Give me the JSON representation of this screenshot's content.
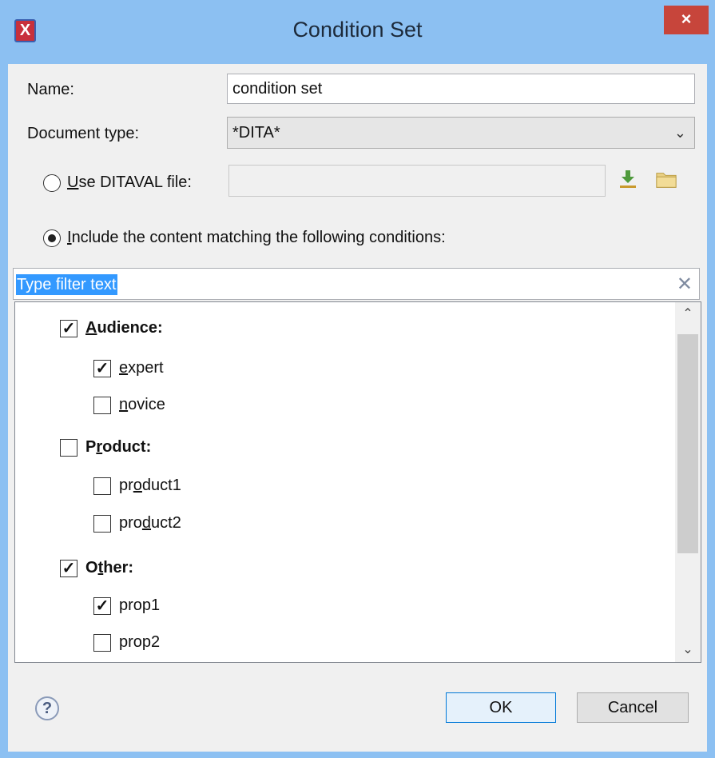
{
  "window": {
    "title": "Condition Set",
    "close_glyph": "×"
  },
  "form": {
    "name_label": "Name:",
    "name_value": "condition set",
    "doctype_label": "Document type:",
    "doctype_value": "*DITA*",
    "ditaval_label": "Use DITAVAL file:",
    "ditaval_value": "",
    "include_label": "Include the content matching the following conditions:",
    "filter_placeholder": "Type filter text"
  },
  "tree": [
    {
      "label": "Audience:",
      "checked": true,
      "children": [
        {
          "label": "expert",
          "checked": true
        },
        {
          "label": "novice",
          "checked": false
        }
      ]
    },
    {
      "label": "Product:",
      "checked": false,
      "children": [
        {
          "label": "product1",
          "checked": false
        },
        {
          "label": "product2",
          "checked": false
        }
      ]
    },
    {
      "label": "Other:",
      "checked": true,
      "children": [
        {
          "label": "prop1",
          "checked": true
        },
        {
          "label": "prop2",
          "checked": false
        }
      ]
    }
  ],
  "buttons": {
    "ok": "OK",
    "cancel": "Cancel",
    "help": "?"
  },
  "icons": {
    "app": "oxygen-x-icon",
    "download": "download-arrow-icon",
    "folder": "folder-icon",
    "clear": "clear-filter-icon"
  },
  "colors": {
    "titlebar": "#8cc0f2",
    "close": "#c7453b",
    "selection": "#3399ff"
  }
}
